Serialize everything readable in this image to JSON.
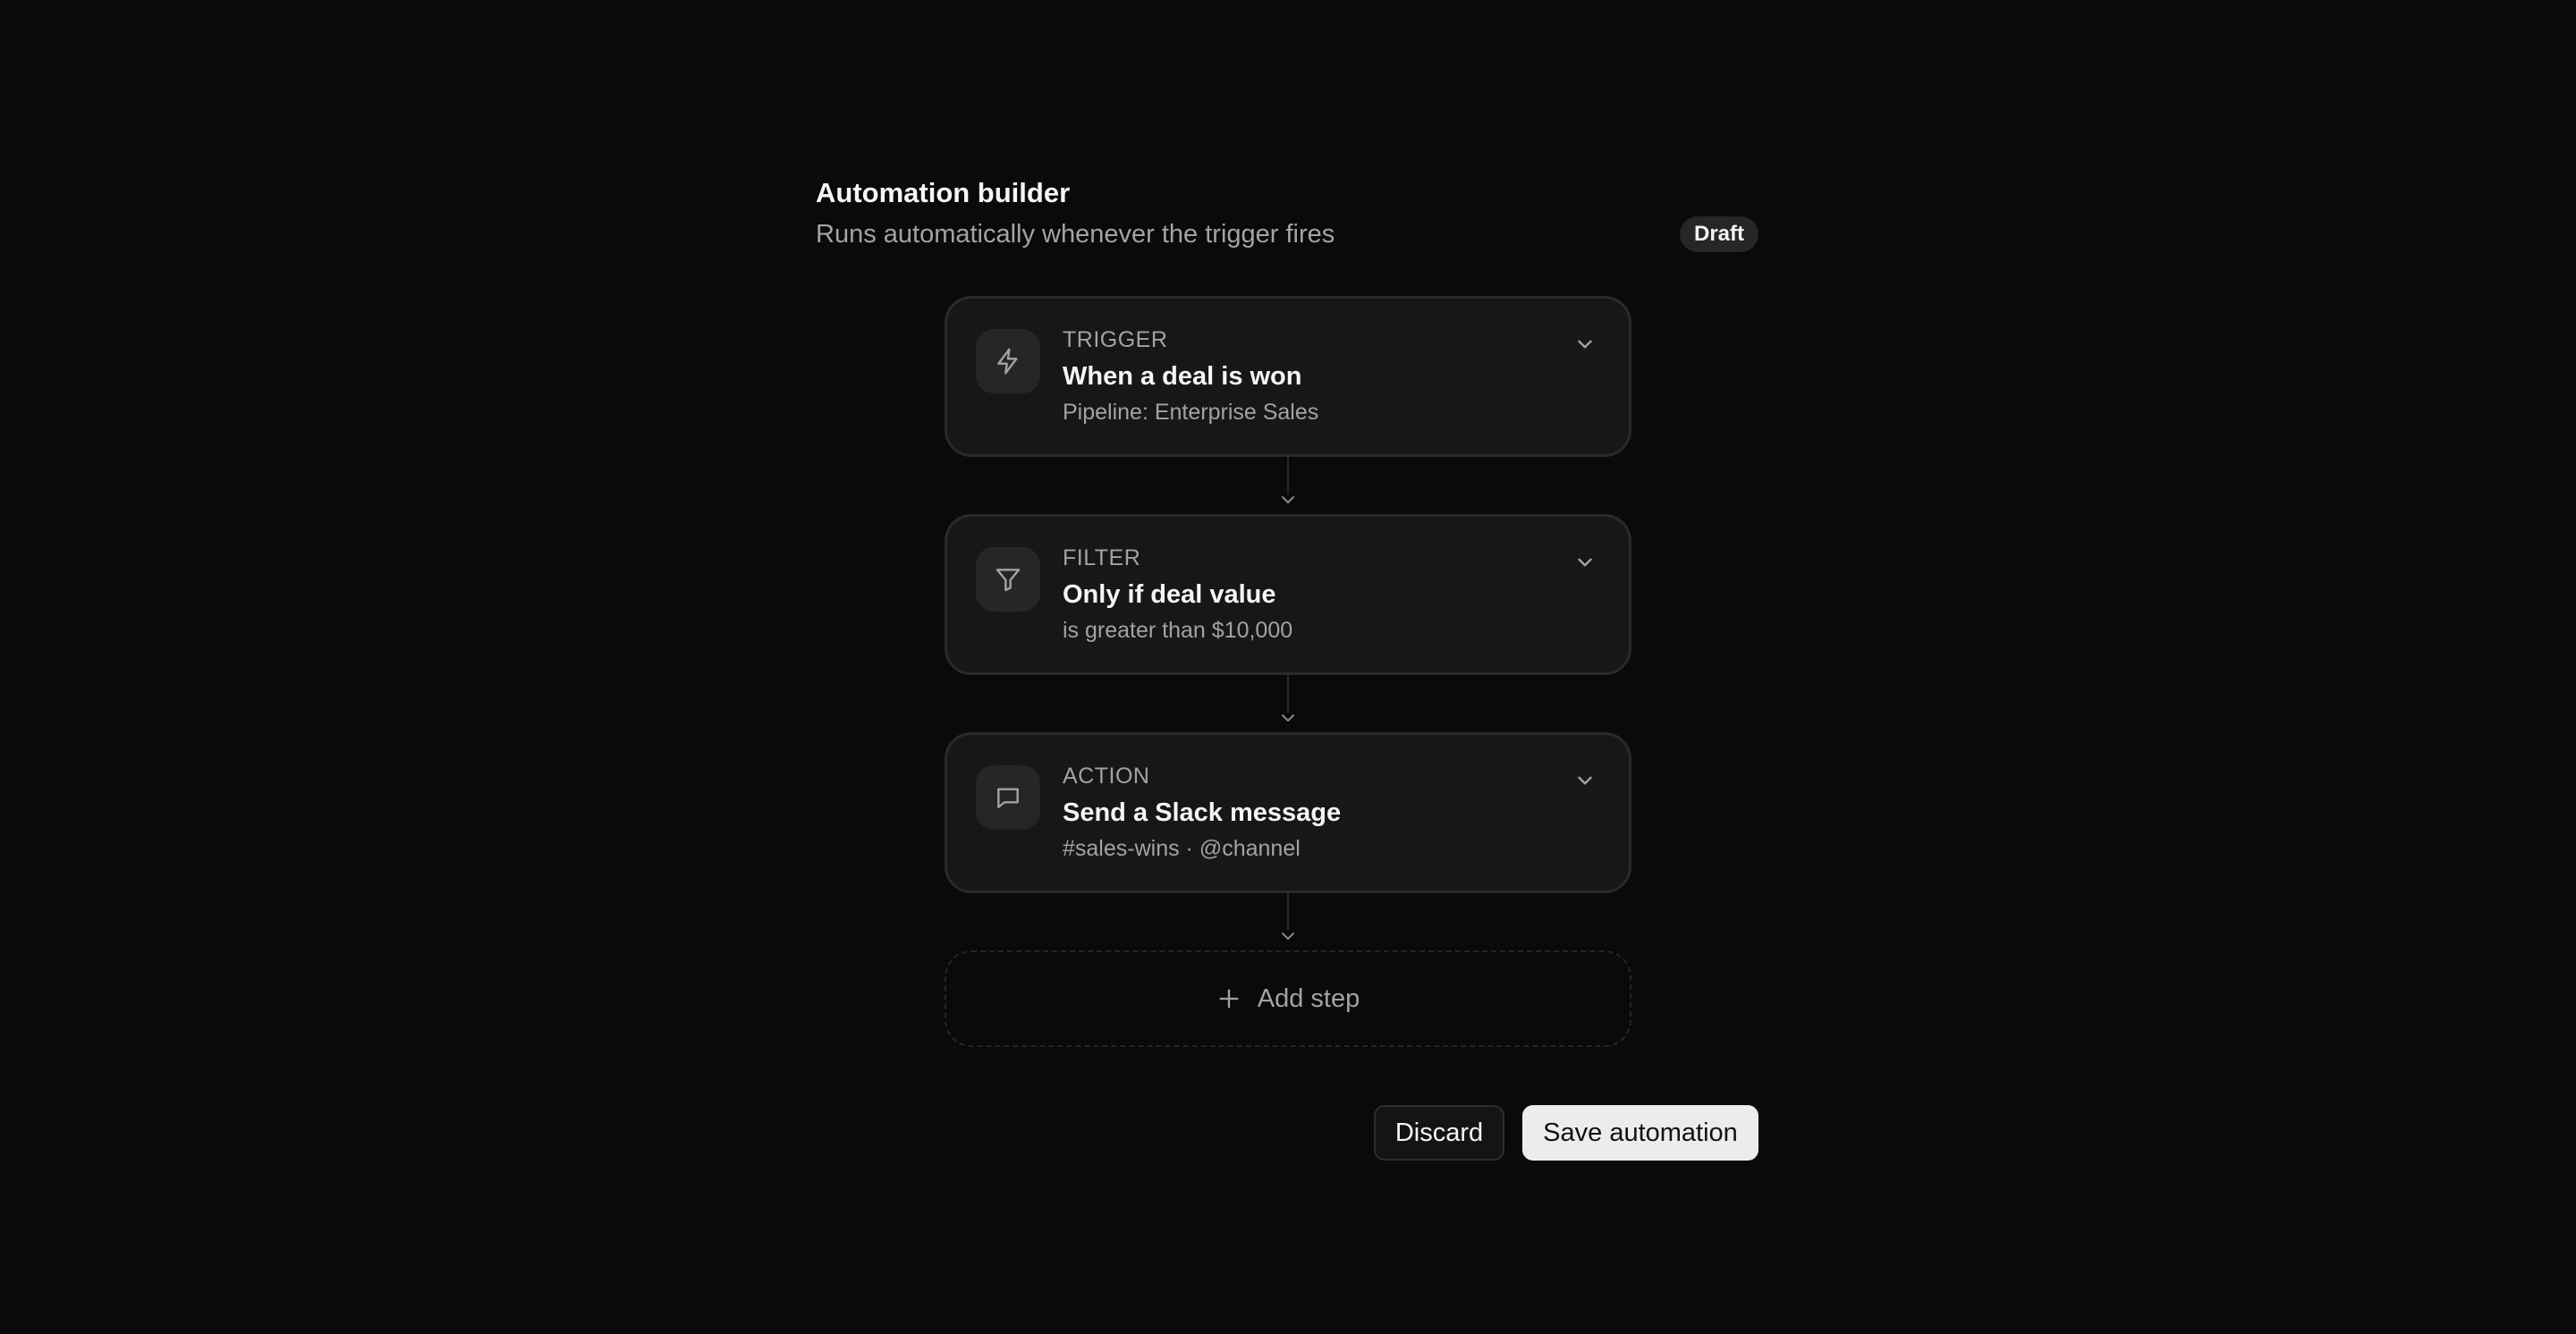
{
  "header": {
    "title": "Automation builder",
    "subtitle": "Runs automatically whenever the trigger fires",
    "status_badge": "Draft"
  },
  "steps": [
    {
      "kind": "TRIGGER",
      "title": "When a deal is won",
      "detail": "Pipeline: Enterprise Sales",
      "icon": "lightning-icon"
    },
    {
      "kind": "FILTER",
      "title": "Only if deal value",
      "detail": "is greater than $10,000",
      "icon": "filter-icon"
    },
    {
      "kind": "ACTION",
      "title": "Send a Slack message",
      "detail": "#sales-wins · @channel",
      "icon": "message-icon"
    }
  ],
  "add_step": {
    "label": "Add step",
    "icon": "plus-icon"
  },
  "footer": {
    "discard_label": "Discard",
    "save_label": "Save automation"
  },
  "colors": {
    "background": "#0a0a0a",
    "card": "#171717",
    "card_border": "#2a2a2a",
    "muted_text": "#a3a3a3",
    "primary_button": "#ececec"
  }
}
